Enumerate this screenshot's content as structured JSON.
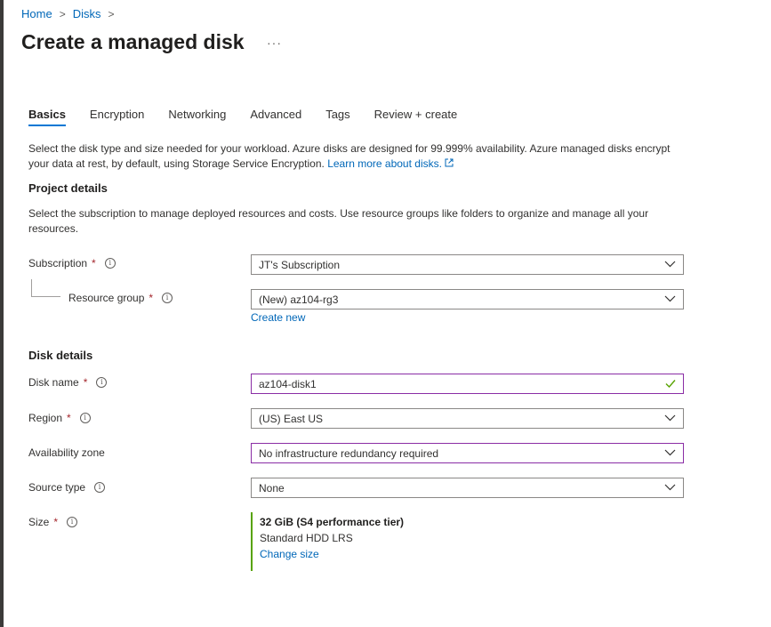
{
  "breadcrumb": {
    "home": "Home",
    "disks": "Disks",
    "separator": ">"
  },
  "page": {
    "title": "Create a managed disk",
    "more": "···"
  },
  "tabs": [
    {
      "label": "Basics",
      "active": true
    },
    {
      "label": "Encryption",
      "active": false
    },
    {
      "label": "Networking",
      "active": false
    },
    {
      "label": "Advanced",
      "active": false
    },
    {
      "label": "Tags",
      "active": false
    },
    {
      "label": "Review + create",
      "active": false
    }
  ],
  "intro": {
    "text": "Select the disk type and size needed for your workload. Azure disks are designed for 99.999% availability. Azure managed disks encrypt your data at rest, by default, using Storage Service Encryption.",
    "link": "Learn more about disks."
  },
  "project": {
    "heading": "Project details",
    "description": "Select the subscription to manage deployed resources and costs. Use resource groups like folders to organize and manage all your resources.",
    "subscription": {
      "label": "Subscription",
      "value": "JT's Subscription"
    },
    "resource_group": {
      "label": "Resource group",
      "value": "(New) az104-rg3",
      "create_new": "Create new"
    }
  },
  "disk": {
    "heading": "Disk details",
    "name": {
      "label": "Disk name",
      "value": "az104-disk1"
    },
    "region": {
      "label": "Region",
      "value": "(US) East US"
    },
    "zone": {
      "label": "Availability zone",
      "value": "No infrastructure redundancy required"
    },
    "source": {
      "label": "Source type",
      "value": "None"
    },
    "size": {
      "label": "Size",
      "title": "32 GiB (S4 performance tier)",
      "sku": "Standard HDD LRS",
      "change": "Change size"
    }
  },
  "common": {
    "required": "*",
    "info": "i"
  },
  "colors": {
    "accent": "#0078d4",
    "link": "#0067b8",
    "focus": "#8a2da5",
    "valid": "#57a300",
    "required": "#a4262c"
  }
}
